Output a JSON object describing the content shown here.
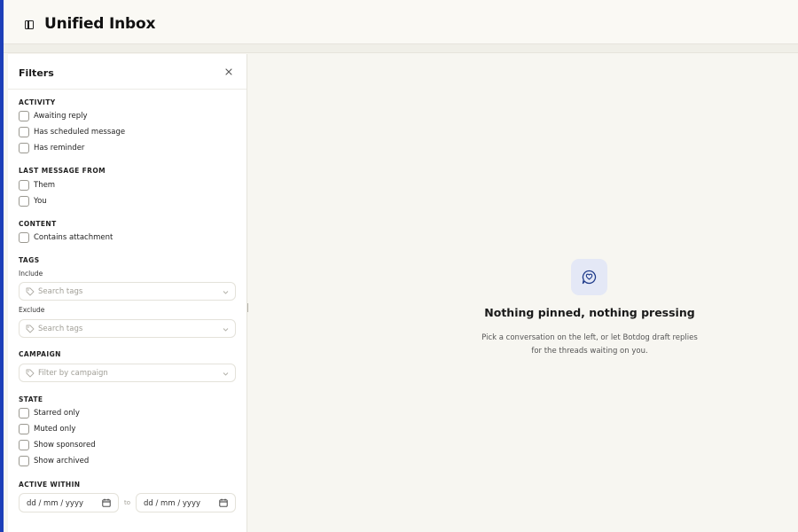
{
  "header": {
    "title": "Unified Inbox",
    "toggle_icon": "sidebar-toggle-icon"
  },
  "filters": {
    "title": "Filters",
    "close_icon": "close-icon",
    "activity": {
      "label": "ACTIVITY",
      "options": [
        "Awaiting reply",
        "Has scheduled message",
        "Has reminder"
      ]
    },
    "last_message_from": {
      "label": "LAST MESSAGE FROM",
      "options": [
        "Them",
        "You"
      ]
    },
    "content": {
      "label": "CONTENT",
      "options": [
        "Contains attachment"
      ]
    },
    "tags": {
      "label": "TAGS",
      "include_label": "Include",
      "include_placeholder": "Search tags",
      "exclude_label": "Exclude",
      "exclude_placeholder": "Search tags"
    },
    "campaign": {
      "label": "CAMPAIGN",
      "placeholder": "Filter by campaign"
    },
    "state": {
      "label": "STATE",
      "options": [
        "Starred only",
        "Muted only",
        "Show sponsored",
        "Show archived"
      ]
    },
    "active_within": {
      "label": "ACTIVE WITHIN",
      "from_placeholder": "dd / mm / yyyy",
      "separator": "to",
      "to_placeholder": "dd / mm / yyyy"
    }
  },
  "empty_state": {
    "icon": "chat-heart-icon",
    "title": "Nothing pinned, nothing pressing",
    "description_line1": "Pick a conversation on the left, or let Botdog draft replies",
    "description_line2": "for the threads waiting on you."
  },
  "colors": {
    "accent_bar": "#1d3fb8",
    "icon_tile": "#e4e8f6",
    "icon_stroke": "#1e3a8a",
    "background": "#f7f6f1"
  }
}
